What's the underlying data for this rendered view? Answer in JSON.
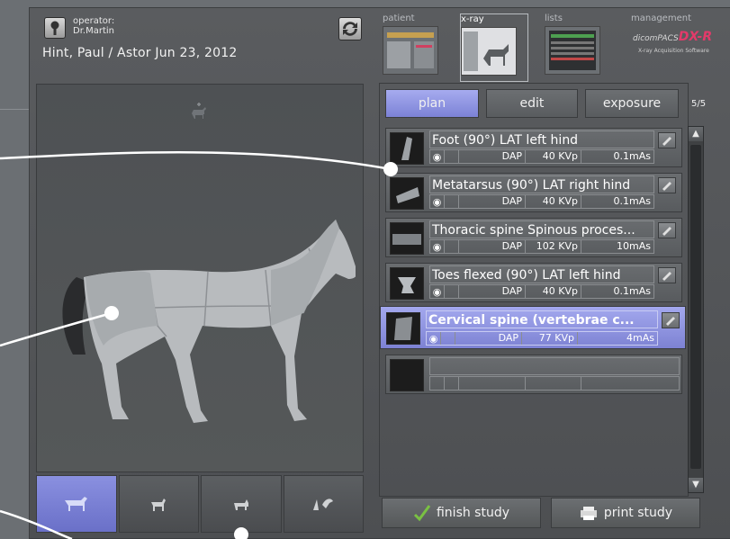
{
  "header": {
    "operator_label": "operator:",
    "operator_name": "Dr.Martin",
    "patient_line": "Hint, Paul / Astor  Jun 23, 2012"
  },
  "tabs": [
    {
      "label": "patient",
      "active": false
    },
    {
      "label": "x-ray",
      "active": true
    },
    {
      "label": "lists",
      "active": false
    },
    {
      "label": "management",
      "active": false
    }
  ],
  "management_logo": {
    "prefix": "dicomPACS",
    "brand": "DX-R",
    "subtitle": "X-ray Acquisition Software",
    "brand_color": "#e23a6a"
  },
  "mode_buttons": [
    {
      "label": "plan",
      "active": true
    },
    {
      "label": "edit",
      "active": false
    },
    {
      "label": "exposure",
      "active": false
    }
  ],
  "page_indicator": "5/5",
  "exam_list": [
    {
      "title": "Foot (90°) LAT left hind",
      "dap": "DAP",
      "kvp": "40 KVp",
      "mas": "0.1mAs",
      "selected": false
    },
    {
      "title": "Metatarsus (90°) LAT right hind",
      "dap": "DAP",
      "kvp": "40 KVp",
      "mas": "0.1mAs",
      "selected": false
    },
    {
      "title": "Thoracic spine Spinous proces...",
      "dap": "DAP",
      "kvp": "102 KVp",
      "mas": "10mAs",
      "selected": false
    },
    {
      "title": "Toes flexed (90°) LAT left hind",
      "dap": "DAP",
      "kvp": "40 KVp",
      "mas": "0.1mAs",
      "selected": false
    },
    {
      "title": "Cervical spine (vertebrae c...",
      "dap": "DAP",
      "kvp": "77 KVp",
      "mas": "4mAs",
      "selected": true
    },
    {
      "title": "",
      "dap": "",
      "kvp": "",
      "mas": "",
      "selected": false
    }
  ],
  "species_buttons": [
    {
      "icon": "horse-icon",
      "selected": true
    },
    {
      "icon": "dog-icon",
      "selected": false
    },
    {
      "icon": "cat-icon",
      "selected": false
    },
    {
      "icon": "bird-icon",
      "selected": false
    }
  ],
  "actions": {
    "finish": "finish study",
    "print": "print study"
  },
  "colors": {
    "accent": "#8a90e0",
    "background": "#4d4f52"
  }
}
